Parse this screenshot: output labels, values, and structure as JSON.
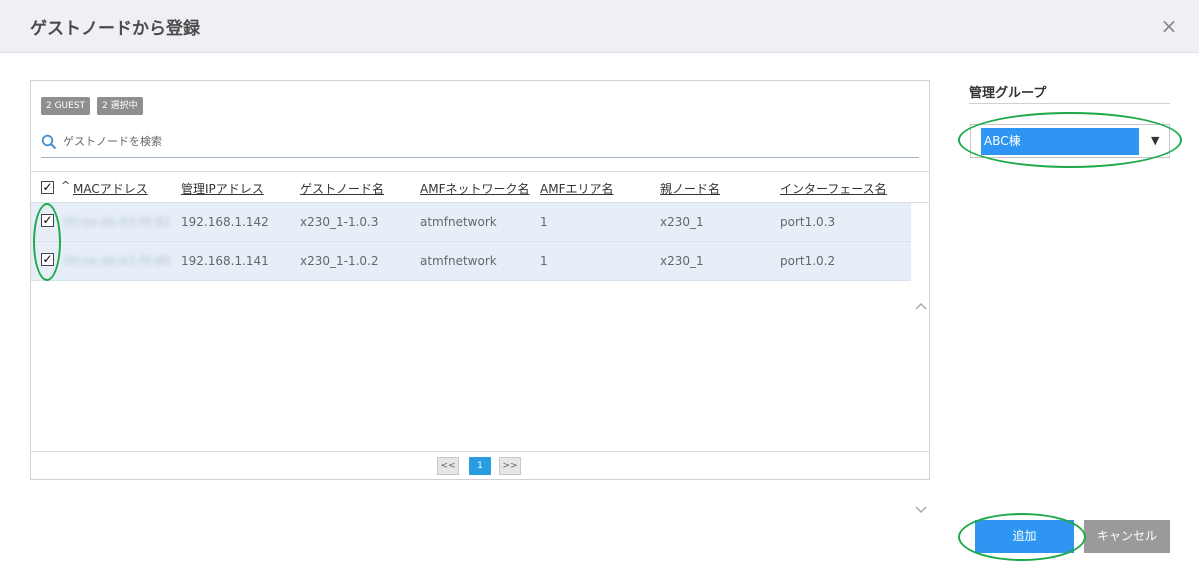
{
  "dialog": {
    "title": "ゲストノードから登録",
    "close_label": "×"
  },
  "badges": {
    "guest_count": "2 GUEST",
    "selected_count": "2 選択中"
  },
  "search": {
    "placeholder": "ゲストノードを検索"
  },
  "table": {
    "sort_indicator": "^",
    "columns": [
      "MACアドレス",
      "管理IPアドレス",
      "ゲストノード名",
      "AMFネットワーク名",
      "AMFエリア名",
      "親ノード名",
      "インターフェース名"
    ],
    "rows": [
      {
        "checked": true,
        "mac": "00:ee:ab:63:f9:82",
        "ip": "192.168.1.142",
        "guest_name": "x230_1-1.0.3",
        "network": "atmfnetwork",
        "area": "1",
        "parent": "x230_1",
        "interface": "port1.0.3"
      },
      {
        "checked": true,
        "mac": "00:ee:ab:63:f9:80",
        "ip": "192.168.1.141",
        "guest_name": "x230_1-1.0.2",
        "network": "atmfnetwork",
        "area": "1",
        "parent": "x230_1",
        "interface": "port1.0.2"
      }
    ]
  },
  "pager": {
    "prev": "<<",
    "current": "1",
    "next": ">>"
  },
  "group": {
    "label": "管理グループ",
    "selected": "ABC棟"
  },
  "buttons": {
    "add": "追加",
    "cancel": "キャンセル"
  },
  "colors": {
    "accent": "#2e95f2",
    "highlight_ring": "#1ea94a",
    "row_selected": "#e6eff8"
  }
}
